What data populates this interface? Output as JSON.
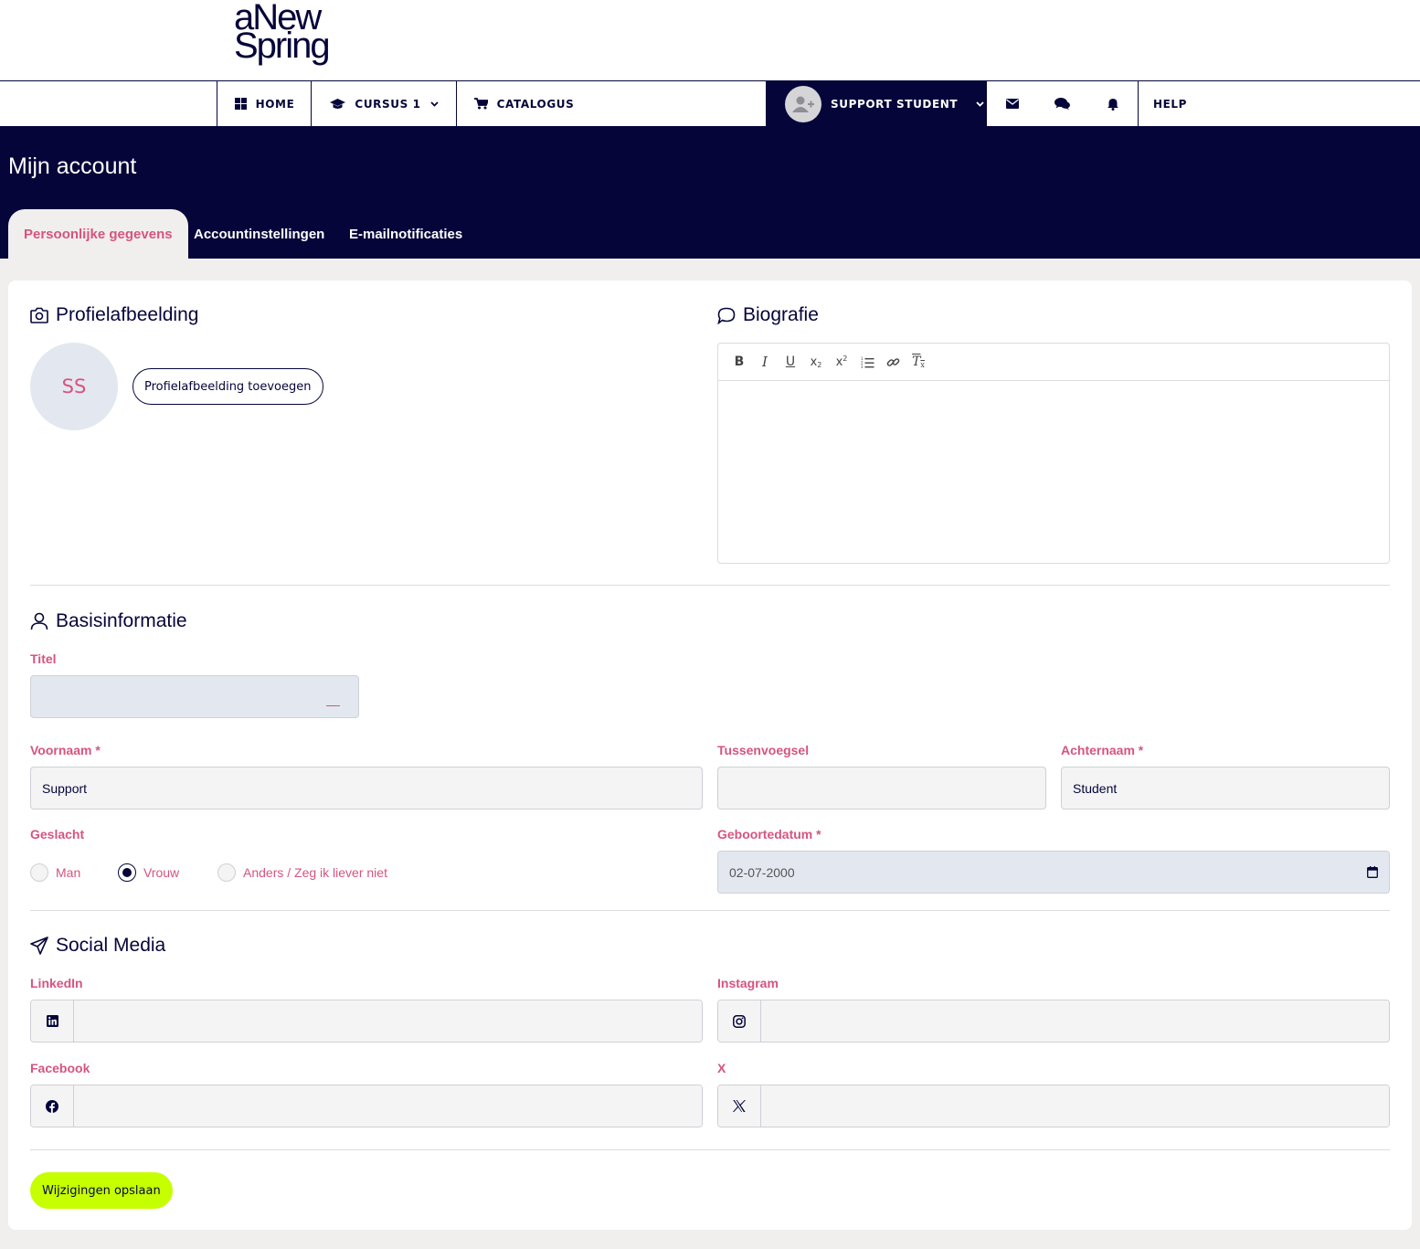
{
  "logo": {
    "line1": "aNew",
    "line2": "Spring"
  },
  "nav": {
    "home": "HOME",
    "course": "CURSUS 1",
    "catalogue": "CATALOGUS",
    "user": "SUPPORT STUDENT",
    "help": "HELP"
  },
  "header": {
    "title": "Mijn account",
    "tabs": [
      "Persoonlijke gegevens",
      "Accountinstellingen",
      "E-mailnotificaties"
    ]
  },
  "profile": {
    "title": "Profielafbeelding",
    "initials": "SS",
    "add_button": "Profielafbeelding toevoegen"
  },
  "bio": {
    "title": "Biografie"
  },
  "basic": {
    "title": "Basisinformatie",
    "titel_label": "Titel",
    "firstname_label": "Voornaam *",
    "firstname_value": "Support",
    "infix_label": "Tussenvoegsel",
    "infix_value": "",
    "lastname_label": "Achternaam *",
    "lastname_value": "Student",
    "gender_label": "Geslacht",
    "gender_options": [
      "Man",
      "Vrouw",
      "Anders / Zeg ik liever niet"
    ],
    "gender_selected": "Vrouw",
    "birthdate_label": "Geboortedatum *",
    "birthdate_value": "02-07-2000"
  },
  "social": {
    "title": "Social Media",
    "linkedin_label": "LinkedIn",
    "instagram_label": "Instagram",
    "facebook_label": "Facebook",
    "x_label": "X"
  },
  "save_button": "Wijzigingen opslaan",
  "colors": {
    "navy": "#05053a",
    "pink": "#d6547e",
    "lime": "#c6ff00"
  }
}
